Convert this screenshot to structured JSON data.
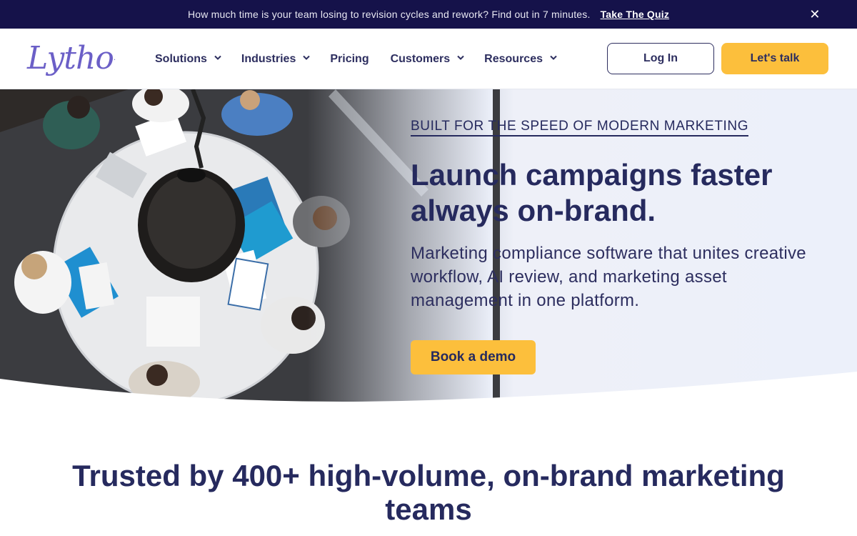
{
  "announcement": {
    "message": "How much time is your team losing to revision cycles and rework? Find out in 7 minutes.",
    "link_label": "Take The Quiz",
    "close_icon": "close-icon"
  },
  "header": {
    "logo_text": "Lytho",
    "nav": [
      {
        "label": "Solutions",
        "has_dropdown": true
      },
      {
        "label": "Industries",
        "has_dropdown": true
      },
      {
        "label": "Pricing",
        "has_dropdown": false
      },
      {
        "label": "Customers",
        "has_dropdown": true
      },
      {
        "label": "Resources",
        "has_dropdown": true
      }
    ],
    "login_label": "Log In",
    "talk_label": "Let's talk"
  },
  "hero": {
    "eyebrow": "BUILT FOR THE SPEED OF MODERN MARKETING",
    "title": "Launch campaigns faster always on-brand.",
    "subtitle": "Marketing compliance software that unites creative workflow, AI review, and marketing asset management in one platform.",
    "cta_label": "Book a demo"
  },
  "trusted": {
    "heading": "Trusted by 400+ high-volume, on-brand marketing teams"
  },
  "colors": {
    "announce_bg": "#15124a",
    "brand_navy": "#262a5e",
    "accent_yellow": "#fcbf3c",
    "logo_purple": "#6b5fc7",
    "hero_bg": "#ecf0fa"
  }
}
